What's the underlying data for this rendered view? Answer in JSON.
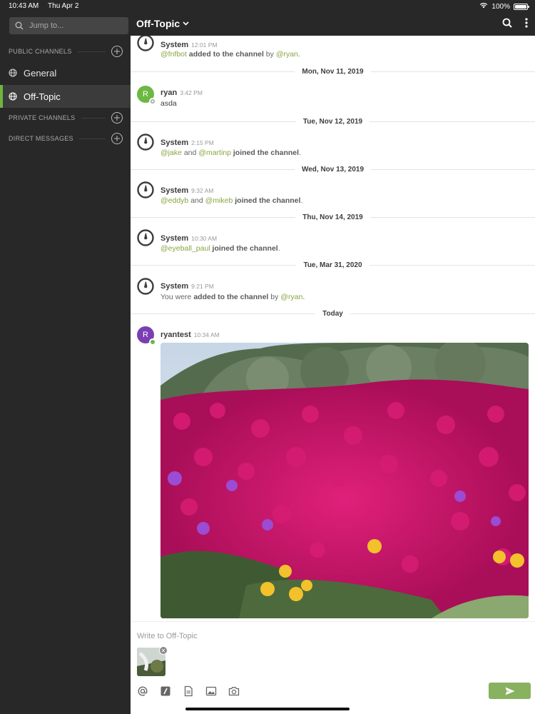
{
  "status_bar": {
    "time": "10:43 AM",
    "date": "Thu Apr 2",
    "battery": "100%"
  },
  "sidebar": {
    "search_placeholder": "Jump to...",
    "sections": {
      "public": "PUBLIC CHANNELS",
      "private": "PRIVATE CHANNELS",
      "direct": "DIRECT MESSAGES"
    },
    "channels": [
      {
        "label": "General",
        "active": false
      },
      {
        "label": "Off-Topic",
        "active": true
      }
    ]
  },
  "header": {
    "title": "Off-Topic"
  },
  "messages": {
    "m1": {
      "author": "System",
      "time": "12:01 PM",
      "u1": "@fnfbot",
      "a1": "added to the channel",
      "w1": "by",
      "u2": "@ryan",
      "end": "."
    },
    "sep1": "Mon, Nov 11, 2019",
    "m2": {
      "author": "ryan",
      "time": "3:42 PM",
      "text": "asda",
      "initial": "R"
    },
    "sep2": "Tue, Nov 12, 2019",
    "m3": {
      "author": "System",
      "time": "2:15 PM",
      "u1": "@jake",
      "w1": "and",
      "u2": "@martinp",
      "a1": "joined the channel",
      "end": "."
    },
    "sep3": "Wed, Nov 13, 2019",
    "m4": {
      "author": "System",
      "time": "9:32 AM",
      "u1": "@eddyb",
      "w1": "and",
      "u2": "@mikeb",
      "a1": "joined the channel",
      "end": "."
    },
    "sep4": "Thu, Nov 14, 2019",
    "m5": {
      "author": "System",
      "time": "10:30 AM",
      "u1": "@eyeball_paul",
      "a1": "joined the channel",
      "end": "."
    },
    "sep5": "Tue, Mar 31, 2020",
    "m6": {
      "author": "System",
      "time": "9:21 PM",
      "w0": "You were",
      "a1": "added to the channel",
      "w1": "by",
      "u1": "@ryan",
      "end": "."
    },
    "sep6": "Today",
    "m7": {
      "author": "ryantest",
      "time": "10:34 AM",
      "initial": "R"
    }
  },
  "composer": {
    "placeholder": "Write to Off-Topic"
  },
  "colors": {
    "sidebar_bg": "#282828",
    "active_indicator": "#6eb43f",
    "mention": "#88a542",
    "send_button": "#88b160",
    "avatar_ryan": "#6cb843",
    "avatar_ryantest": "#7b3fb3"
  }
}
